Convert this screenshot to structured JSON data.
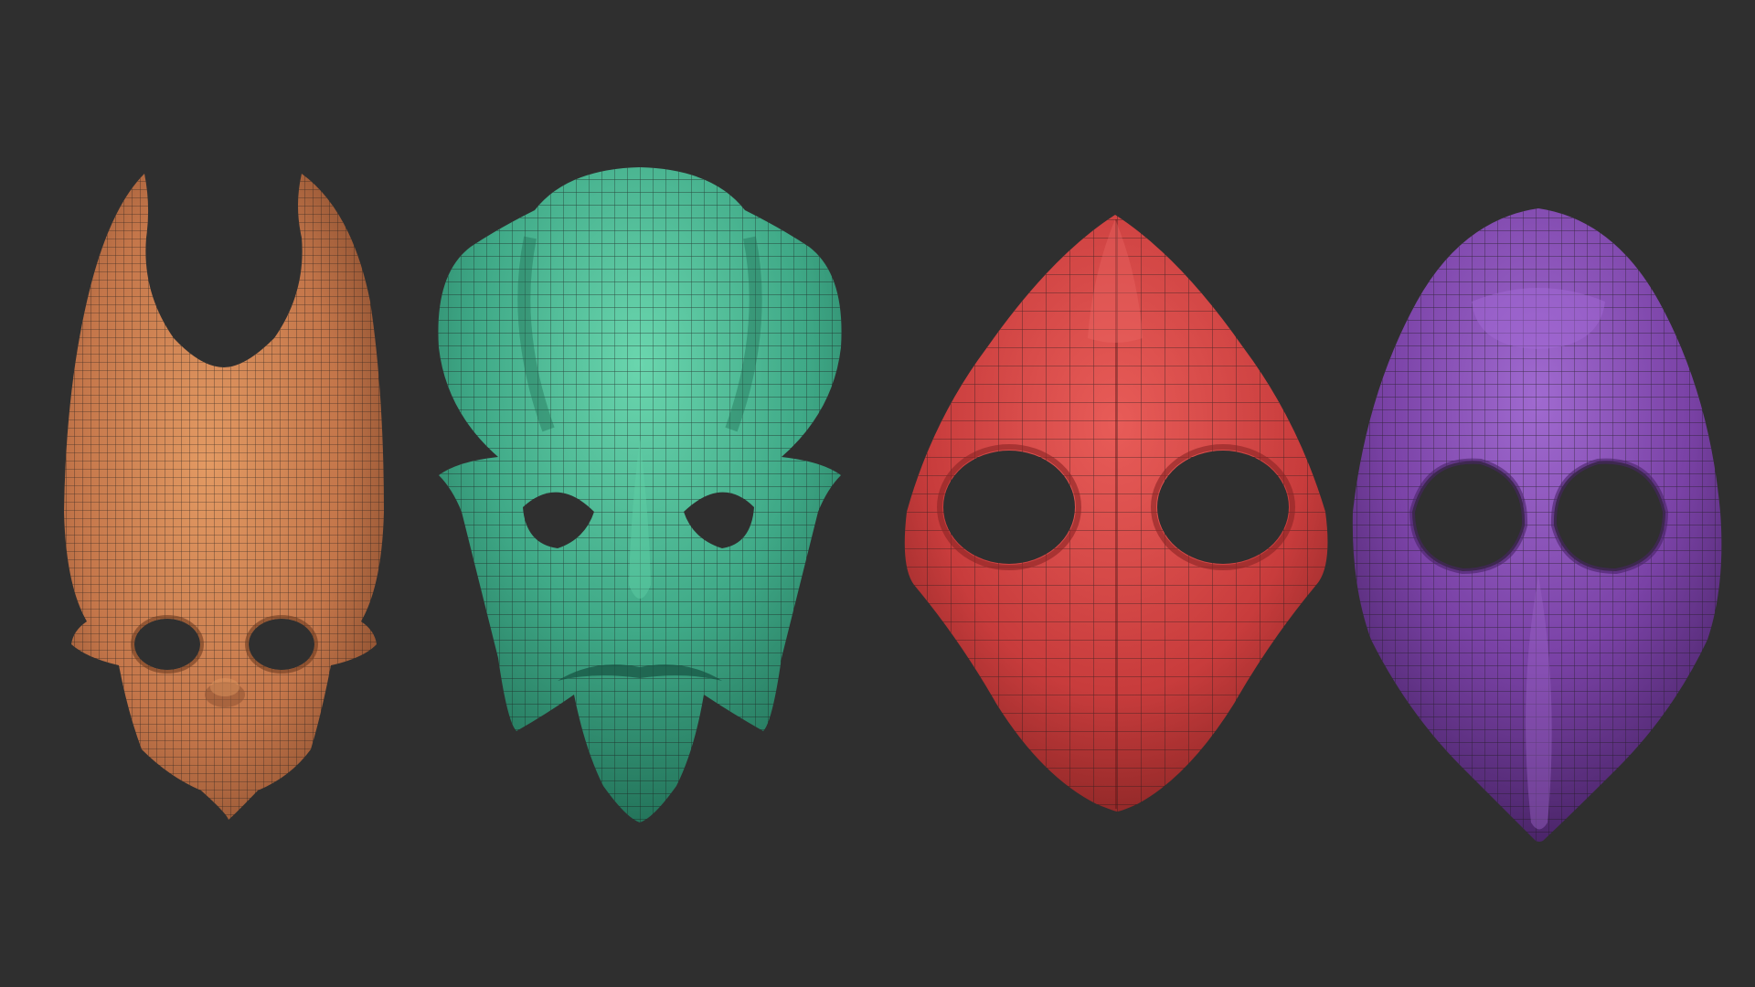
{
  "scene": {
    "background_color": "#2f2f2f",
    "mesh_line_color": "#1a1a1a",
    "masks": [
      {
        "name": "horned-mask",
        "color": "#c4764a",
        "highlight": "#e0955f",
        "shadow": "#7a4328"
      },
      {
        "name": "bulbous-mask",
        "color": "#3fa987",
        "highlight": "#63d1aa",
        "shadow": "#1f6b53"
      },
      {
        "name": "diamond-mask",
        "color": "#c83c3c",
        "highlight": "#e45a56",
        "shadow": "#7a2020"
      },
      {
        "name": "beak-mask",
        "color": "#7a42a6",
        "highlight": "#9a62c6",
        "shadow": "#43205f"
      }
    ]
  }
}
